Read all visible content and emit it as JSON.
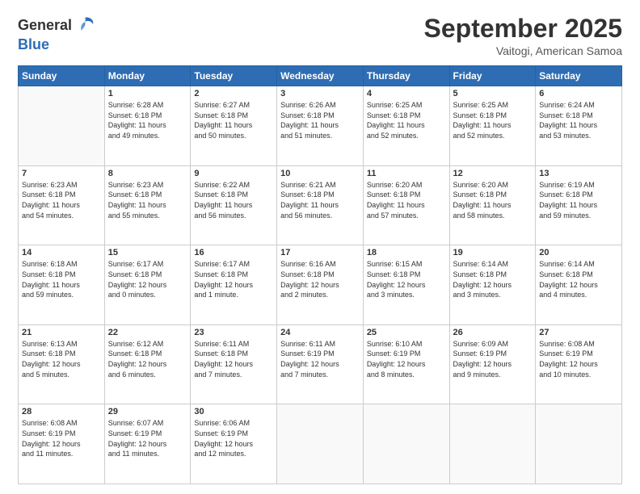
{
  "header": {
    "logo_general": "General",
    "logo_blue": "Blue",
    "month": "September 2025",
    "location": "Vaitogi, American Samoa"
  },
  "days_of_week": [
    "Sunday",
    "Monday",
    "Tuesday",
    "Wednesday",
    "Thursday",
    "Friday",
    "Saturday"
  ],
  "weeks": [
    [
      {
        "day": "",
        "info": ""
      },
      {
        "day": "1",
        "info": "Sunrise: 6:28 AM\nSunset: 6:18 PM\nDaylight: 11 hours\nand 49 minutes."
      },
      {
        "day": "2",
        "info": "Sunrise: 6:27 AM\nSunset: 6:18 PM\nDaylight: 11 hours\nand 50 minutes."
      },
      {
        "day": "3",
        "info": "Sunrise: 6:26 AM\nSunset: 6:18 PM\nDaylight: 11 hours\nand 51 minutes."
      },
      {
        "day": "4",
        "info": "Sunrise: 6:25 AM\nSunset: 6:18 PM\nDaylight: 11 hours\nand 52 minutes."
      },
      {
        "day": "5",
        "info": "Sunrise: 6:25 AM\nSunset: 6:18 PM\nDaylight: 11 hours\nand 52 minutes."
      },
      {
        "day": "6",
        "info": "Sunrise: 6:24 AM\nSunset: 6:18 PM\nDaylight: 11 hours\nand 53 minutes."
      }
    ],
    [
      {
        "day": "7",
        "info": "Sunrise: 6:23 AM\nSunset: 6:18 PM\nDaylight: 11 hours\nand 54 minutes."
      },
      {
        "day": "8",
        "info": "Sunrise: 6:23 AM\nSunset: 6:18 PM\nDaylight: 11 hours\nand 55 minutes."
      },
      {
        "day": "9",
        "info": "Sunrise: 6:22 AM\nSunset: 6:18 PM\nDaylight: 11 hours\nand 56 minutes."
      },
      {
        "day": "10",
        "info": "Sunrise: 6:21 AM\nSunset: 6:18 PM\nDaylight: 11 hours\nand 56 minutes."
      },
      {
        "day": "11",
        "info": "Sunrise: 6:20 AM\nSunset: 6:18 PM\nDaylight: 11 hours\nand 57 minutes."
      },
      {
        "day": "12",
        "info": "Sunrise: 6:20 AM\nSunset: 6:18 PM\nDaylight: 11 hours\nand 58 minutes."
      },
      {
        "day": "13",
        "info": "Sunrise: 6:19 AM\nSunset: 6:18 PM\nDaylight: 11 hours\nand 59 minutes."
      }
    ],
    [
      {
        "day": "14",
        "info": "Sunrise: 6:18 AM\nSunset: 6:18 PM\nDaylight: 11 hours\nand 59 minutes."
      },
      {
        "day": "15",
        "info": "Sunrise: 6:17 AM\nSunset: 6:18 PM\nDaylight: 12 hours\nand 0 minutes."
      },
      {
        "day": "16",
        "info": "Sunrise: 6:17 AM\nSunset: 6:18 PM\nDaylight: 12 hours\nand 1 minute."
      },
      {
        "day": "17",
        "info": "Sunrise: 6:16 AM\nSunset: 6:18 PM\nDaylight: 12 hours\nand 2 minutes."
      },
      {
        "day": "18",
        "info": "Sunrise: 6:15 AM\nSunset: 6:18 PM\nDaylight: 12 hours\nand 3 minutes."
      },
      {
        "day": "19",
        "info": "Sunrise: 6:14 AM\nSunset: 6:18 PM\nDaylight: 12 hours\nand 3 minutes."
      },
      {
        "day": "20",
        "info": "Sunrise: 6:14 AM\nSunset: 6:18 PM\nDaylight: 12 hours\nand 4 minutes."
      }
    ],
    [
      {
        "day": "21",
        "info": "Sunrise: 6:13 AM\nSunset: 6:18 PM\nDaylight: 12 hours\nand 5 minutes."
      },
      {
        "day": "22",
        "info": "Sunrise: 6:12 AM\nSunset: 6:18 PM\nDaylight: 12 hours\nand 6 minutes."
      },
      {
        "day": "23",
        "info": "Sunrise: 6:11 AM\nSunset: 6:18 PM\nDaylight: 12 hours\nand 7 minutes."
      },
      {
        "day": "24",
        "info": "Sunrise: 6:11 AM\nSunset: 6:19 PM\nDaylight: 12 hours\nand 7 minutes."
      },
      {
        "day": "25",
        "info": "Sunrise: 6:10 AM\nSunset: 6:19 PM\nDaylight: 12 hours\nand 8 minutes."
      },
      {
        "day": "26",
        "info": "Sunrise: 6:09 AM\nSunset: 6:19 PM\nDaylight: 12 hours\nand 9 minutes."
      },
      {
        "day": "27",
        "info": "Sunrise: 6:08 AM\nSunset: 6:19 PM\nDaylight: 12 hours\nand 10 minutes."
      }
    ],
    [
      {
        "day": "28",
        "info": "Sunrise: 6:08 AM\nSunset: 6:19 PM\nDaylight: 12 hours\nand 11 minutes."
      },
      {
        "day": "29",
        "info": "Sunrise: 6:07 AM\nSunset: 6:19 PM\nDaylight: 12 hours\nand 11 minutes."
      },
      {
        "day": "30",
        "info": "Sunrise: 6:06 AM\nSunset: 6:19 PM\nDaylight: 12 hours\nand 12 minutes."
      },
      {
        "day": "",
        "info": ""
      },
      {
        "day": "",
        "info": ""
      },
      {
        "day": "",
        "info": ""
      },
      {
        "day": "",
        "info": ""
      }
    ]
  ]
}
